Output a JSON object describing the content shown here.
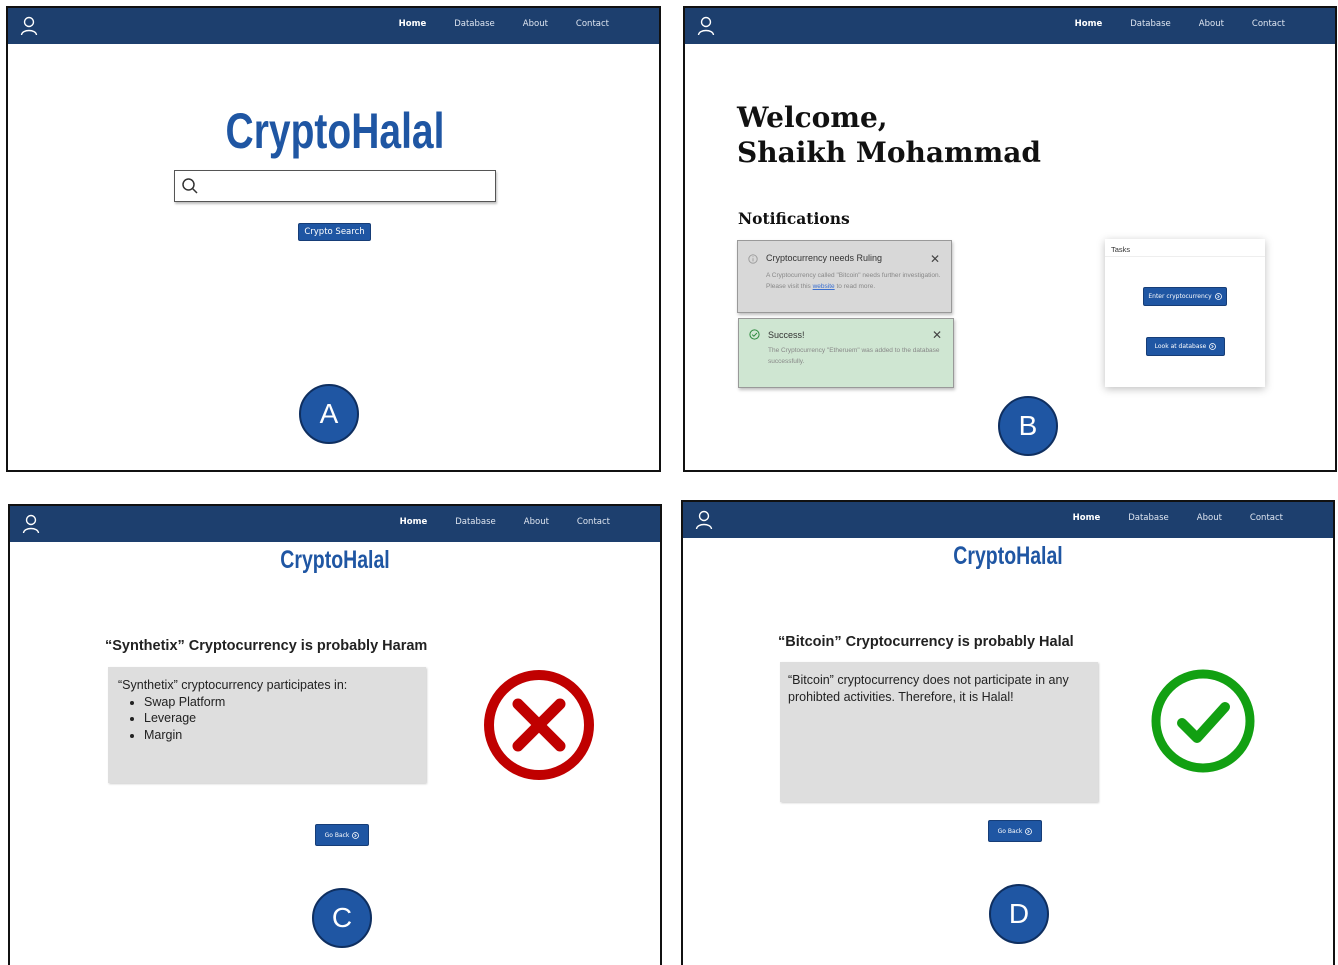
{
  "nav": {
    "user_icon": "user-icon",
    "links": [
      "Home",
      "Database",
      "About",
      "Contact"
    ]
  },
  "panel_a": {
    "badge": "A",
    "brand": "CryptoHalal",
    "search_icon": "search-icon",
    "search_value": "",
    "button": "Crypto Search"
  },
  "panel_b": {
    "badge": "B",
    "welcome_line1": "Welcome,",
    "welcome_line2": "Shaikh Mohammad",
    "notifications_heading": "Notifications",
    "notif1": {
      "icon": "info-icon",
      "title": "Cryptocurrency needs Ruling",
      "body_before": "A Cryptocurrency called \"Bitcoin\" needs further investigation. Please visit this ",
      "link": "website",
      "body_after": " to read more.",
      "close": "✕"
    },
    "notif2": {
      "icon": "check-circle-icon",
      "title": "Success!",
      "body": "The Cryptocurrency \"Etheruem\" was added to the database successfully.",
      "close": "✕"
    },
    "tasks": {
      "title": "Tasks",
      "button1": "Enter cryptocurrency",
      "button2": "Look at database"
    }
  },
  "panel_c": {
    "badge": "C",
    "brand": "CryptoHalal",
    "heading": "“Synthetix” Cryptocurrency is probably Haram",
    "intro": "“Synthetix” cryptocurrency participates in:",
    "items": [
      "Swap Platform",
      "Leverage",
      "Margin"
    ],
    "button": "Go Back",
    "status_icon": "x-circle-icon"
  },
  "panel_d": {
    "badge": "D",
    "brand": "CryptoHalal",
    "heading": "“Bitcoin” Cryptocurrency is probably Halal",
    "body": "“Bitcoin” cryptocurrency does not participate in any prohibted activities. Therefore, it is Halal!",
    "button": "Go Back",
    "status_icon": "check-circle-icon"
  },
  "colors": {
    "navbar": "#1d3f6e",
    "brand": "#1f56a3",
    "haram_red": "#c00000",
    "halal_green": "#12a012"
  }
}
